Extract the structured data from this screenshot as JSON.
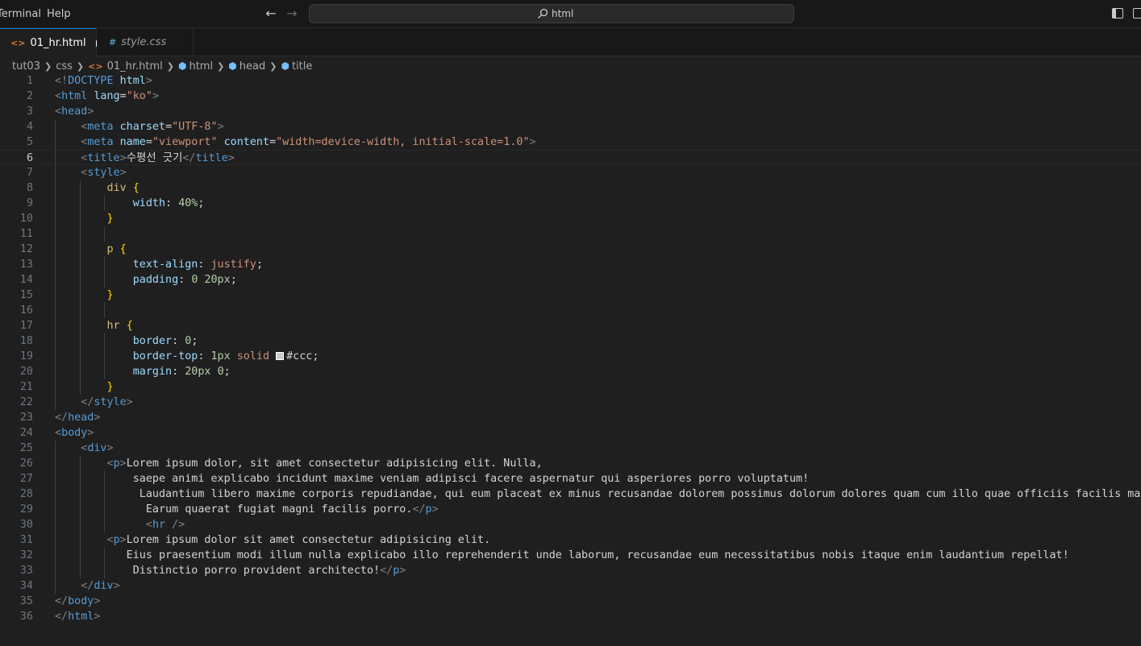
{
  "menu": {
    "terminal": "Terminal",
    "help": "Help"
  },
  "search": {
    "label": "html"
  },
  "tabs": [
    {
      "label": "01_hr.html",
      "icon": "<>"
    },
    {
      "label": "style.css",
      "icon": "#"
    }
  ],
  "breadcrumb": [
    "tut03",
    "css",
    "01_hr.html",
    "html",
    "head",
    "title"
  ],
  "editor": {
    "current_line": 6,
    "lines": [
      "<!DOCTYPE html>",
      "<html lang=\"ko\">",
      "<head>",
      "    <meta charset=\"UTF-8\">",
      "    <meta name=\"viewport\" content=\"width=device-width, initial-scale=1.0\">",
      "    <title>수평선 긋기</title>",
      "    <style>",
      "        div {",
      "            width: 40%;",
      "        }",
      "",
      "        p {",
      "            text-align: justify;",
      "            padding: 0 20px;",
      "        }",
      "",
      "        hr {",
      "            border: 0;",
      "            border-top: 1px solid #ccc;",
      "            margin: 20px 0;",
      "        }",
      "    </style>",
      "</head>",
      "<body>",
      "    <div>",
      "        <p>Lorem ipsum dolor, sit amet consectetur adipisicing elit. Nulla,",
      "            saepe animi explicabo incidunt maxime veniam adipisci facere aspernatur qui asperiores porro voluptatum!",
      "             Laudantium libero maxime corporis repudiandae, qui eum placeat ex minus recusandae dolorem possimus dolorum dolores quam cum illo quae officiis facilis magni.",
      "              Earum quaerat fugiat magni facilis porro.</p>",
      "              <hr />",
      "        <p>Lorem ipsum dolor sit amet consectetur adipisicing elit.",
      "           Eius praesentium modi illum nulla explicabo illo reprehenderit unde laborum, recusandae eum necessitatibus nobis itaque enim laudantium repellat!",
      "            Distinctio porro provident architecto!</p>",
      "    </div>",
      "</body>",
      "</html>"
    ],
    "colors": {
      "swatch": "#cccccc",
      "accent": "#0078d4",
      "background": "#1f1f1f"
    }
  }
}
